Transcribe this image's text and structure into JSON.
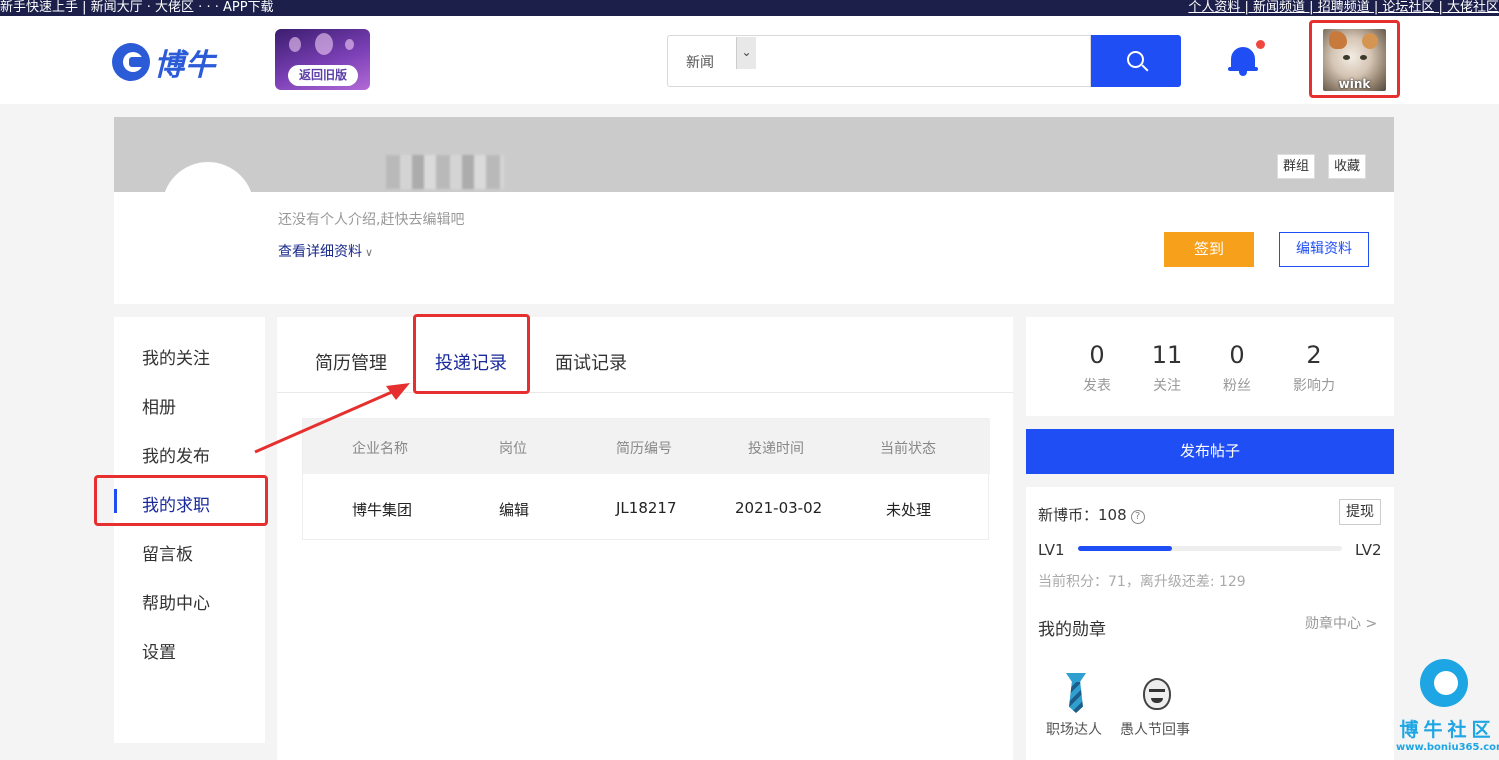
{
  "topbar": {
    "left_text": "新手快速上手 | 新闻大厅 · 大佬区 · · · APP下载",
    "right_text": "个人资料 | 新闻频道 | 招聘频道 | 论坛社区 | 大佬社区"
  },
  "header": {
    "logo_text": "博牛",
    "old_version_label": "返回旧版",
    "search": {
      "category": "新闻",
      "placeholder": ""
    },
    "avatar_caption": "wink"
  },
  "profile": {
    "tags": [
      "群组",
      "收藏"
    ],
    "intro": "还没有个人介绍,赶快去编辑吧",
    "view_details": "查看详细资料",
    "checkin_label": "签到",
    "edit_label": "编辑资料"
  },
  "sidenav": {
    "items": [
      "我的关注",
      "相册",
      "我的发布",
      "我的求职",
      "留言板",
      "帮助中心",
      "设置"
    ],
    "active": "我的求职"
  },
  "main": {
    "tabs": [
      "简历管理",
      "投递记录",
      "面试记录"
    ],
    "active_tab": "投递记录",
    "table": {
      "headers": [
        "企业名称",
        "岗位",
        "简历编号",
        "投递时间",
        "当前状态"
      ],
      "rows": [
        [
          "博牛集团",
          "编辑",
          "JL18217",
          "2021-03-02",
          "未处理"
        ]
      ]
    }
  },
  "stats": [
    {
      "value": "0",
      "label": "发表"
    },
    {
      "value": "11",
      "label": "关注"
    },
    {
      "value": "0",
      "label": "粉丝"
    },
    {
      "value": "2",
      "label": "影响力"
    }
  ],
  "publish_label": "发布帖子",
  "wallet": {
    "coins_label": "新博币：108",
    "help_icon": "?",
    "withdraw_label": "提现",
    "level_from": "LV1",
    "level_to": "LV2",
    "level_progress": 0.355,
    "score_text": "当前积分：71，离升级还差: 129",
    "medals_title": "我的勋章",
    "medals_link": "勋章中心 >",
    "medals": [
      "职场达人",
      "愚人节回事"
    ]
  },
  "watermark": {
    "title": "博牛社区",
    "url": "www.boniu365.com"
  },
  "colors": {
    "accent": "#1f4ef5",
    "highlight": "#e62f2f",
    "checkin": "#f7a01c"
  }
}
